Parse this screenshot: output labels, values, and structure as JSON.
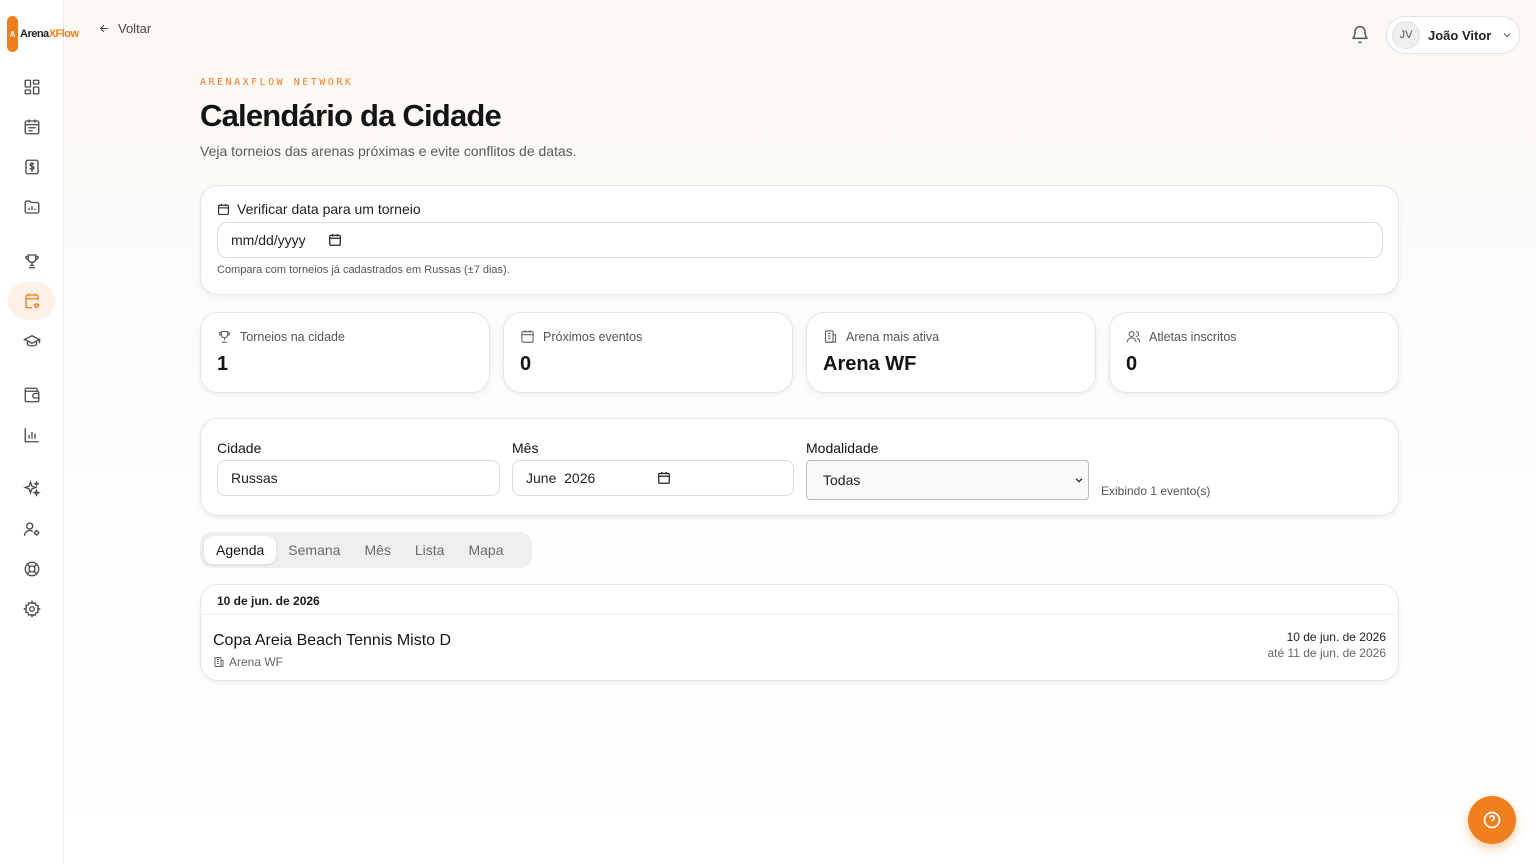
{
  "brand": {
    "mark": "A",
    "name_a": "Arena",
    "name_b": "XFlow",
    "accent": "#f07f1f"
  },
  "sidebar": {
    "items": [
      {
        "icon": "dashboard-icon"
      },
      {
        "icon": "calendar-list-icon"
      },
      {
        "icon": "dollar-icon"
      },
      {
        "icon": "folder-chart-icon"
      },
      {
        "icon": "trophy-icon"
      },
      {
        "icon": "calendar-heart-icon",
        "active": true
      },
      {
        "icon": "graduation-cap-icon"
      },
      {
        "icon": "wallet-icon"
      },
      {
        "icon": "bar-chart-icon"
      },
      {
        "icon": "sparkles-icon"
      },
      {
        "icon": "user-cog-icon"
      },
      {
        "icon": "lifebuoy-icon"
      },
      {
        "icon": "settings-icon"
      }
    ]
  },
  "header": {
    "back_label": "Voltar",
    "user_initials": "JV",
    "user_name": "João Vitor"
  },
  "page": {
    "eyebrow": "ARENAXFLOW NETWORK",
    "title": "Calendário da Cidade",
    "subtitle": "Veja torneios das arenas próximas e evite conflitos de datas."
  },
  "check": {
    "label": "Verificar data para um torneio",
    "date_value": "mm/dd/yyyy",
    "hint": "Compara com torneios já cadastrados em Russas (±7 dias)."
  },
  "stats": [
    {
      "label": "Torneios na cidade",
      "value": "1",
      "icon": "trophy-icon"
    },
    {
      "label": "Próximos eventos",
      "value": "0",
      "icon": "calendar-icon"
    },
    {
      "label": "Arena mais ativa",
      "value": "Arena WF",
      "icon": "building-icon"
    },
    {
      "label": "Atletas inscritos",
      "value": "0",
      "icon": "users-icon"
    }
  ],
  "filters": {
    "city_label": "Cidade",
    "city_value": "Russas",
    "month_label": "Mês",
    "month_value": "June  2026",
    "mode_label": "Modalidade",
    "mode_value": "Todas",
    "showing": "Exibindo 1 evento(s)"
  },
  "tabs": [
    "Agenda",
    "Semana",
    "Mês",
    "Lista",
    "Mapa"
  ],
  "agenda": {
    "day": "10 de jun. de 2026",
    "event": {
      "title": "Copa Areia Beach Tennis Misto D",
      "arena": "Arena WF",
      "start": "10 de jun. de 2026",
      "until": "até 11 de jun. de 2026"
    }
  }
}
